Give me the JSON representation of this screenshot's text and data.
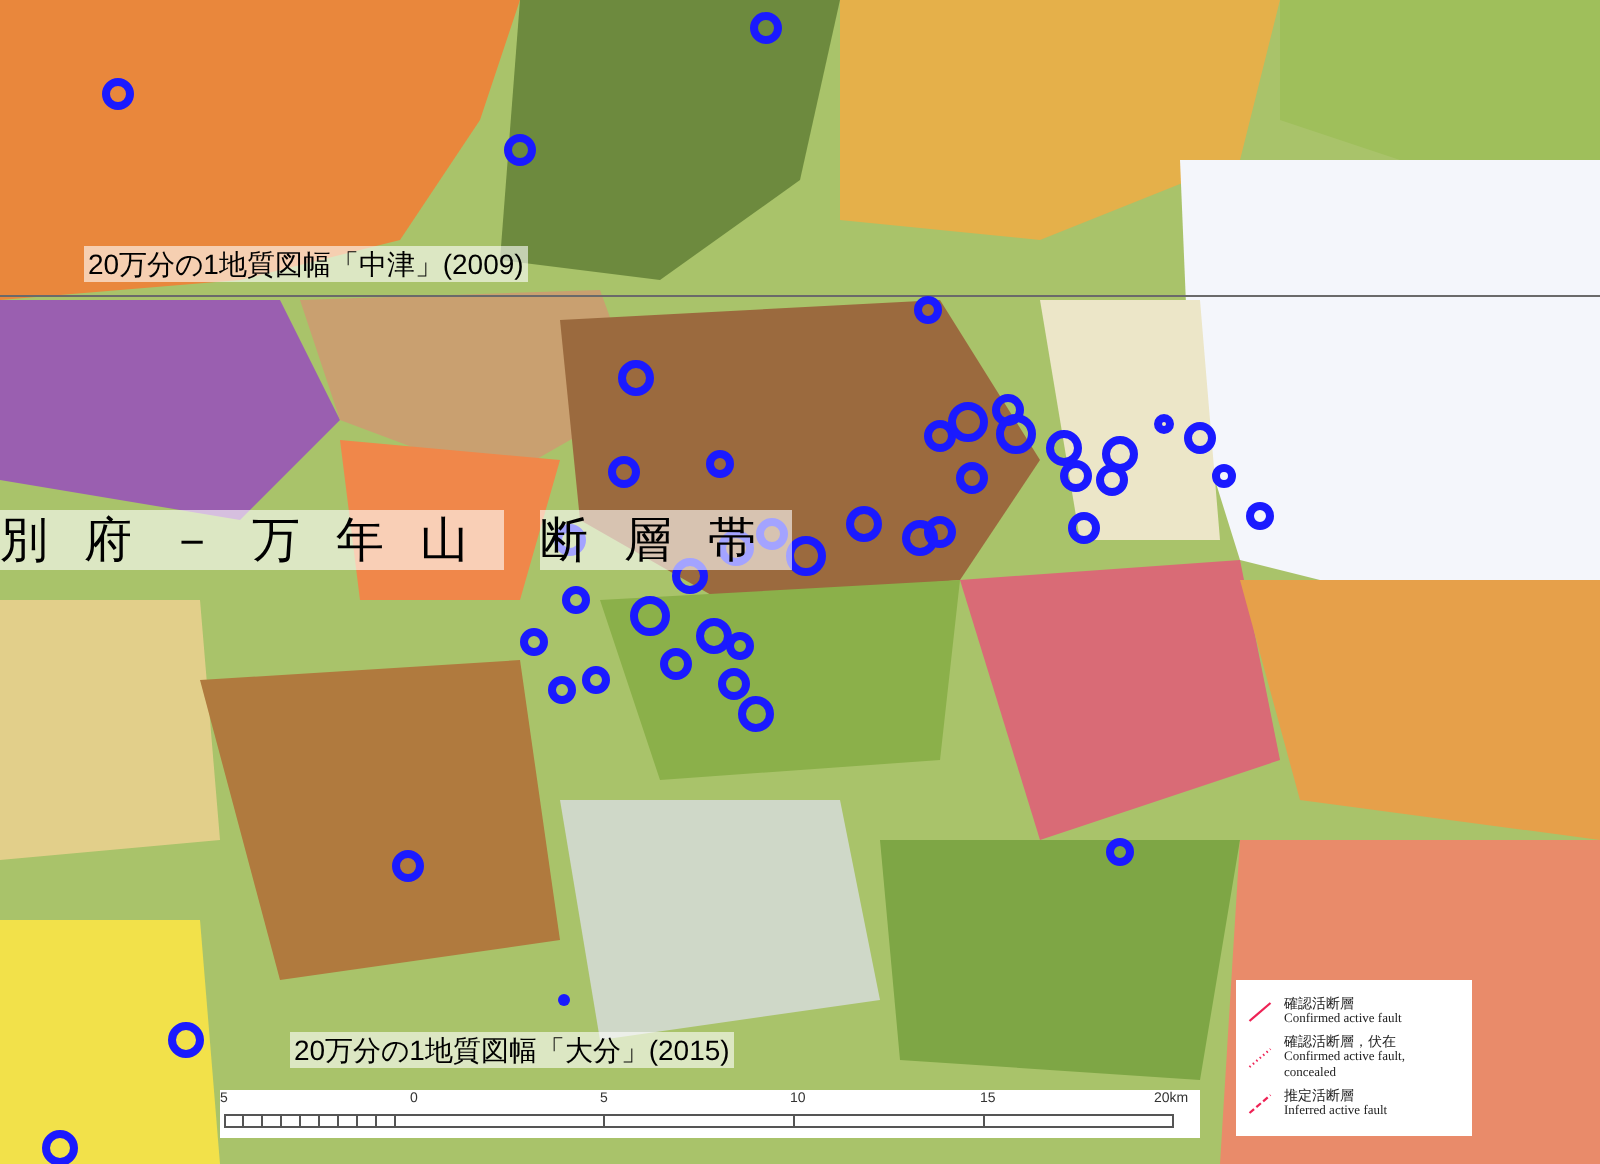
{
  "map_titles": [
    {
      "text": "20万分の1地質図幅「中津」(2009)"
    },
    {
      "text": "20万分の1地質図幅「大分」(2015)"
    }
  ],
  "fault_zone_label": [
    "別府－万年山",
    "断層帯"
  ],
  "legend": [
    {
      "kind": "solid",
      "label_ja": "確認活断層",
      "label_en": "Confirmed active fault"
    },
    {
      "kind": "dotted",
      "label_ja": "確認活断層，伏在",
      "label_en": "Confirmed active fault, concealed"
    },
    {
      "kind": "dashed",
      "label_ja": "推定活断層",
      "label_en": "Inferred active fault"
    }
  ],
  "scale_bar": {
    "ticks": [
      "5",
      "0",
      "5",
      "10",
      "15",
      "20km"
    ]
  }
}
